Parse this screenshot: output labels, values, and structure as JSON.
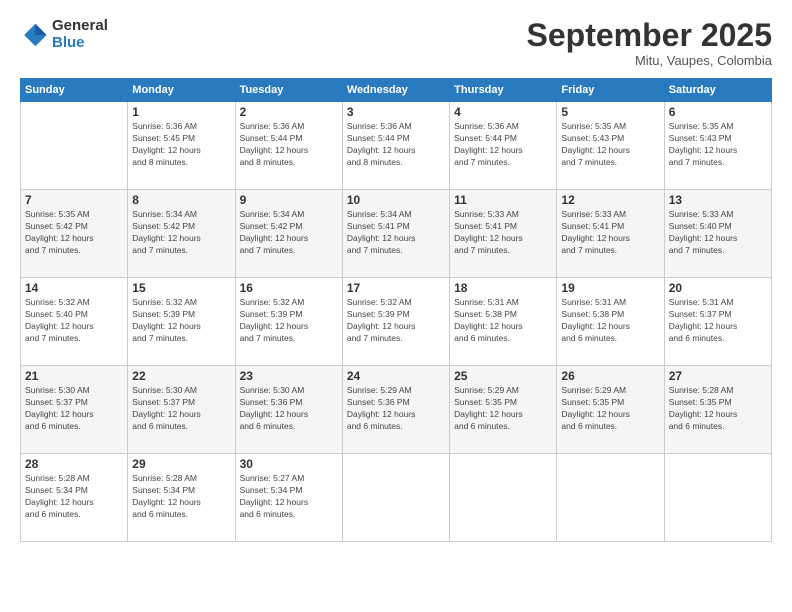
{
  "logo": {
    "general": "General",
    "blue": "Blue"
  },
  "header": {
    "month_title": "September 2025",
    "subtitle": "Mitu, Vaupes, Colombia"
  },
  "days_of_week": [
    "Sunday",
    "Monday",
    "Tuesday",
    "Wednesday",
    "Thursday",
    "Friday",
    "Saturday"
  ],
  "weeks": [
    [
      {
        "day": "",
        "info": ""
      },
      {
        "day": "1",
        "info": "Sunrise: 5:36 AM\nSunset: 5:45 PM\nDaylight: 12 hours\nand 8 minutes."
      },
      {
        "day": "2",
        "info": "Sunrise: 5:36 AM\nSunset: 5:44 PM\nDaylight: 12 hours\nand 8 minutes."
      },
      {
        "day": "3",
        "info": "Sunrise: 5:36 AM\nSunset: 5:44 PM\nDaylight: 12 hours\nand 8 minutes."
      },
      {
        "day": "4",
        "info": "Sunrise: 5:36 AM\nSunset: 5:44 PM\nDaylight: 12 hours\nand 7 minutes."
      },
      {
        "day": "5",
        "info": "Sunrise: 5:35 AM\nSunset: 5:43 PM\nDaylight: 12 hours\nand 7 minutes."
      },
      {
        "day": "6",
        "info": "Sunrise: 5:35 AM\nSunset: 5:43 PM\nDaylight: 12 hours\nand 7 minutes."
      }
    ],
    [
      {
        "day": "7",
        "info": "Sunrise: 5:35 AM\nSunset: 5:42 PM\nDaylight: 12 hours\nand 7 minutes."
      },
      {
        "day": "8",
        "info": "Sunrise: 5:34 AM\nSunset: 5:42 PM\nDaylight: 12 hours\nand 7 minutes."
      },
      {
        "day": "9",
        "info": "Sunrise: 5:34 AM\nSunset: 5:42 PM\nDaylight: 12 hours\nand 7 minutes."
      },
      {
        "day": "10",
        "info": "Sunrise: 5:34 AM\nSunset: 5:41 PM\nDaylight: 12 hours\nand 7 minutes."
      },
      {
        "day": "11",
        "info": "Sunrise: 5:33 AM\nSunset: 5:41 PM\nDaylight: 12 hours\nand 7 minutes."
      },
      {
        "day": "12",
        "info": "Sunrise: 5:33 AM\nSunset: 5:41 PM\nDaylight: 12 hours\nand 7 minutes."
      },
      {
        "day": "13",
        "info": "Sunrise: 5:33 AM\nSunset: 5:40 PM\nDaylight: 12 hours\nand 7 minutes."
      }
    ],
    [
      {
        "day": "14",
        "info": "Sunrise: 5:32 AM\nSunset: 5:40 PM\nDaylight: 12 hours\nand 7 minutes."
      },
      {
        "day": "15",
        "info": "Sunrise: 5:32 AM\nSunset: 5:39 PM\nDaylight: 12 hours\nand 7 minutes."
      },
      {
        "day": "16",
        "info": "Sunrise: 5:32 AM\nSunset: 5:39 PM\nDaylight: 12 hours\nand 7 minutes."
      },
      {
        "day": "17",
        "info": "Sunrise: 5:32 AM\nSunset: 5:39 PM\nDaylight: 12 hours\nand 7 minutes."
      },
      {
        "day": "18",
        "info": "Sunrise: 5:31 AM\nSunset: 5:38 PM\nDaylight: 12 hours\nand 6 minutes."
      },
      {
        "day": "19",
        "info": "Sunrise: 5:31 AM\nSunset: 5:38 PM\nDaylight: 12 hours\nand 6 minutes."
      },
      {
        "day": "20",
        "info": "Sunrise: 5:31 AM\nSunset: 5:37 PM\nDaylight: 12 hours\nand 6 minutes."
      }
    ],
    [
      {
        "day": "21",
        "info": "Sunrise: 5:30 AM\nSunset: 5:37 PM\nDaylight: 12 hours\nand 6 minutes."
      },
      {
        "day": "22",
        "info": "Sunrise: 5:30 AM\nSunset: 5:37 PM\nDaylight: 12 hours\nand 6 minutes."
      },
      {
        "day": "23",
        "info": "Sunrise: 5:30 AM\nSunset: 5:36 PM\nDaylight: 12 hours\nand 6 minutes."
      },
      {
        "day": "24",
        "info": "Sunrise: 5:29 AM\nSunset: 5:36 PM\nDaylight: 12 hours\nand 6 minutes."
      },
      {
        "day": "25",
        "info": "Sunrise: 5:29 AM\nSunset: 5:35 PM\nDaylight: 12 hours\nand 6 minutes."
      },
      {
        "day": "26",
        "info": "Sunrise: 5:29 AM\nSunset: 5:35 PM\nDaylight: 12 hours\nand 6 minutes."
      },
      {
        "day": "27",
        "info": "Sunrise: 5:28 AM\nSunset: 5:35 PM\nDaylight: 12 hours\nand 6 minutes."
      }
    ],
    [
      {
        "day": "28",
        "info": "Sunrise: 5:28 AM\nSunset: 5:34 PM\nDaylight: 12 hours\nand 6 minutes."
      },
      {
        "day": "29",
        "info": "Sunrise: 5:28 AM\nSunset: 5:34 PM\nDaylight: 12 hours\nand 6 minutes."
      },
      {
        "day": "30",
        "info": "Sunrise: 5:27 AM\nSunset: 5:34 PM\nDaylight: 12 hours\nand 6 minutes."
      },
      {
        "day": "",
        "info": ""
      },
      {
        "day": "",
        "info": ""
      },
      {
        "day": "",
        "info": ""
      },
      {
        "day": "",
        "info": ""
      }
    ]
  ]
}
